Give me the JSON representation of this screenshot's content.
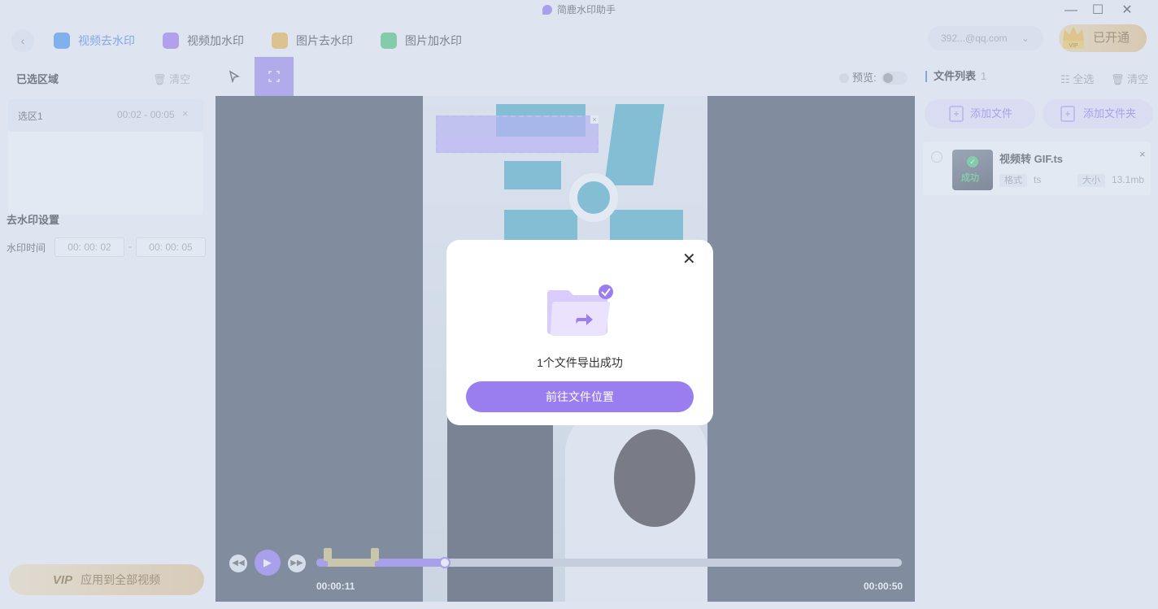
{
  "window": {
    "title": "简鹿水印助手",
    "minimize": "—",
    "maximize": "☐",
    "close": "✕"
  },
  "nav": {
    "back": "‹",
    "tabs": [
      {
        "label": "视频去水印",
        "active": true,
        "icon": "video-remove-icon"
      },
      {
        "label": "视频加水印",
        "active": false,
        "icon": "video-add-icon"
      },
      {
        "label": "图片去水印",
        "active": false,
        "icon": "image-remove-icon"
      },
      {
        "label": "图片加水印",
        "active": false,
        "icon": "image-add-icon"
      }
    ],
    "account": "392...@qq.com",
    "account_chevron": "⌄",
    "vip_label": "已开通",
    "vip_badge": "VIP"
  },
  "left": {
    "selected_title": "已选区域",
    "clear": "清空",
    "regions": [
      {
        "name": "选区1",
        "time": "00:02 - 00:05",
        "close": "×"
      }
    ],
    "settings_title": "去水印设置",
    "time_label": "水印时间",
    "time_start": "00: 00: 02",
    "time_end": "00: 00: 05",
    "time_dash": "-",
    "apply_vip": "VIP",
    "apply_label": "应用到全部视频"
  },
  "toolbar": {
    "preview_label": "预览:",
    "preview_on": false
  },
  "player": {
    "current_time": "00:00:11",
    "total_time": "00:00:50",
    "progress": 0.22,
    "range_start": 0.02,
    "range_end": 0.1,
    "rewind": "◀◀",
    "play": "▶",
    "forward": "▶▶",
    "selection_close": "×"
  },
  "files": {
    "title": "文件列表",
    "count": "1",
    "select_all": "全选",
    "clear": "清空",
    "add_file": "添加文件",
    "add_folder": "添加文件夹",
    "items": [
      {
        "name": "视频转 GIF.ts",
        "format_label": "格式",
        "format": "ts",
        "size_label": "大小",
        "size": "13.1mb",
        "status": "成功",
        "close": "×"
      }
    ]
  },
  "modal": {
    "message": "1个文件导出成功",
    "button": "前往文件位置",
    "close": "✕"
  },
  "colors": {
    "accent": "#8a6cf0",
    "tab_active": "#3a7be6",
    "vip": "#e7bd7a",
    "success": "#41c26b"
  }
}
